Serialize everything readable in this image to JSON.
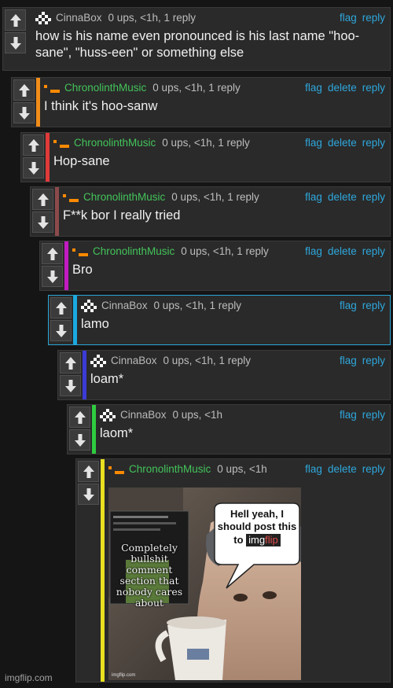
{
  "colors": {
    "accent": "#2ea7dc",
    "green_author": "#43c45a",
    "background": "#151515",
    "panel": "#2a2a2a"
  },
  "actions": {
    "flag": "flag",
    "delete": "delete",
    "reply": "reply"
  },
  "comments": [
    {
      "author": "CinnaBox",
      "stats": "0 ups, <1h, 1 reply",
      "text": "how is his name even pronounced is his last name \"hoo-sane\", \"huss-een\" or something else",
      "bar_color": "#2a2a2a"
    },
    {
      "author": "ChronolinthMusic",
      "stats": "0 ups, <1h, 1 reply",
      "text": "I think it's hoo-sanw",
      "bar_color": "#f08c1a"
    },
    {
      "author": "ChronolinthMusic",
      "stats": "0 ups, <1h, 1 reply",
      "text": "Hop-sane",
      "bar_color": "#e03a3a"
    },
    {
      "author": "ChronolinthMusic",
      "stats": "0 ups, <1h, 1 reply",
      "text": "F**k bor I really tried",
      "bar_color": "#8b4a4a"
    },
    {
      "author": "ChronolinthMusic",
      "stats": "0 ups, <1h, 1 reply",
      "text": "Bro",
      "bar_color": "#c21bc2"
    },
    {
      "author": "CinnaBox",
      "stats": "0 ups, <1h, 1 reply",
      "text": "lamo",
      "bar_color": "#1aa9e0"
    },
    {
      "author": "CinnaBox",
      "stats": "0 ups, <1h, 1 reply",
      "text": "loam*",
      "bar_color": "#3b3bd6"
    },
    {
      "author": "CinnaBox",
      "stats": "0 ups, <1h",
      "text": "laom*",
      "bar_color": "#2ecc40"
    },
    {
      "author": "ChronolinthMusic",
      "stats": "0 ups, <1h",
      "text": "",
      "bar_color": "#e8e020"
    }
  ],
  "meme": {
    "bubble_text": "Hell yeah, I should post this to",
    "logo_left": "img",
    "logo_right": "flip",
    "overlay_text": "Completely bullshit comment section that nobody cares about",
    "corner_mark": "imgflip.com"
  },
  "watermark": "imgflip.com"
}
